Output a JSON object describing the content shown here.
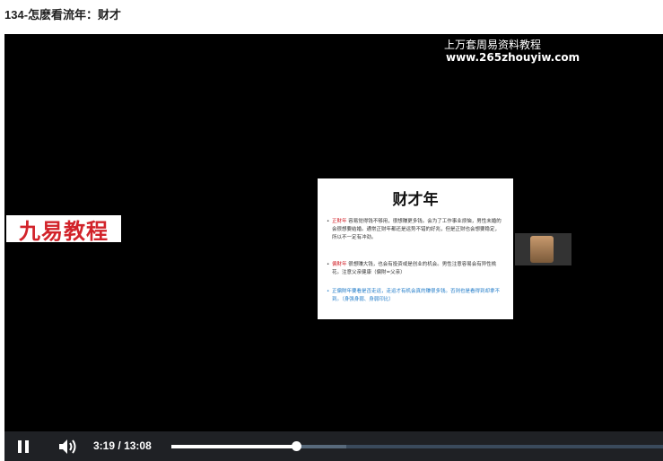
{
  "page": {
    "title": "134-怎麽看流年：财才"
  },
  "video": {
    "watermark_line1": "上万套周易资料教程",
    "watermark_line2": "www.265zhouyiw.com",
    "brand_overlay": "九易教程",
    "slide": {
      "title": "财才年",
      "bullets": [
        {
          "term": "正財年",
          "text": "容易觉得钱不够用，很想赚更多钱。会为了工作事业烦恼，男性未婚的会很想要结婚。通常正财年都还是运势不错的好兆，但是正财也会想要稳定，所以不一定有冲劲。"
        },
        {
          "term": "偏財年",
          "text": "很想赚大钱，也会有投资或是创业的机会。男性注意容易会有异性桃花。注意父亲健康（偏財=父亲）"
        },
        {
          "term": "",
          "text": "正偏財年要看是否走运，走运才有机会真的赚很多钱。否则也是看得到却拿不到。（身强身弱、身弱印比）"
        }
      ]
    }
  },
  "player": {
    "current_time": "3:19",
    "separator": "/",
    "duration": "13:08",
    "progress": 0.253,
    "buffered": 0.356
  },
  "colors": {
    "accent_red": "#d2232a",
    "link_blue": "#1e7ac8",
    "controls_bg": "#1f2125"
  }
}
